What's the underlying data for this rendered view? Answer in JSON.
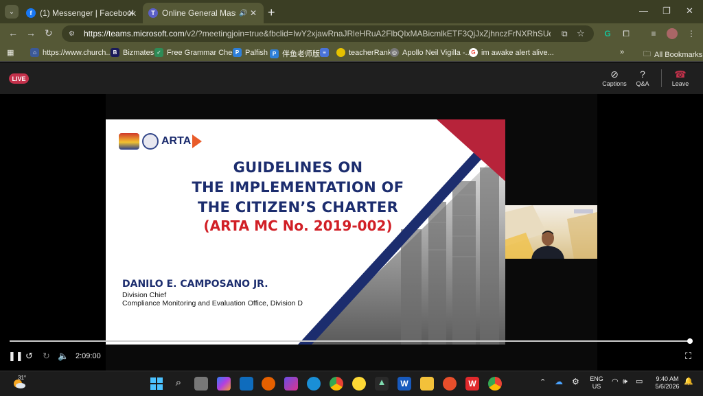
{
  "browser": {
    "tabs": [
      {
        "title": "(1) Messenger | Facebook",
        "favicon": "facebook-icon",
        "color": "#1877f2"
      },
      {
        "title": "Online General Mass Orient",
        "favicon": "teams-icon",
        "color": "#5b5fc7",
        "audio": "🔊"
      }
    ],
    "close_glyph": "✕",
    "new_tab_glyph": "+",
    "url_host": "https://teams.microsoft.com",
    "url_rest": "/v2/?meetingjoin=true&fbclid=IwY2xjawRnaJRleHRuA2FlbQIxMABicmlkETF3QjJxZjhnczFrNXRhSUdHc3J0YWZhcHBfaW...",
    "bookmarks": [
      {
        "label": "https://www.church...",
        "color": "#3b5998"
      },
      {
        "label": "Bizmates",
        "color": "#1a1a5a",
        "glyph": "B"
      },
      {
        "label": "Free Grammar Chec...",
        "color": "#2e8b57"
      },
      {
        "label": "Palfish",
        "color": "#2e7fd9"
      },
      {
        "label": "伴鱼老师版",
        "color": "#2e7fd9"
      },
      {
        "label": "",
        "color": "#4a73d9"
      },
      {
        "label": "teacherRank",
        "color": "#e6c200"
      },
      {
        "label": "Apollo Neil Vigilla -...",
        "color": "#777"
      },
      {
        "label": "im awake alert alive...",
        "color": "#ea4335",
        "glyph": "G"
      }
    ],
    "bookmarks_overflow": "»",
    "all_bookmarks": "All Bookmarks"
  },
  "teams": {
    "live_label": "LIVE",
    "captions_label": "Captions",
    "qa_label": "Q&A",
    "leave_label": "Leave",
    "leave_color": "#c4314b"
  },
  "slide": {
    "agency": "ARTA",
    "seal_caption": "BAGONG PILIPINAS",
    "title_lines": [
      "GUIDELINES ON",
      "THE IMPLEMENTATION OF",
      "THE CITIZEN’S CHARTER"
    ],
    "subtitle": "(ARTA MC No. 2019-002)",
    "speaker_name": "DANILO E. CAMPOSANO JR.",
    "speaker_role": "Division Chief",
    "speaker_office": "Compliance Monitoring and Evaluation Office, Division D",
    "title_color": "#1c2d6e",
    "subtitle_color": "#d11f26"
  },
  "player": {
    "time": "2:09:00",
    "progress": 1.0
  },
  "taskbar": {
    "temperature": "31°",
    "lang_top": "ENG",
    "lang_bottom": "US",
    "clock_time": "9:40 AM",
    "clock_date": "5/6/2026"
  }
}
